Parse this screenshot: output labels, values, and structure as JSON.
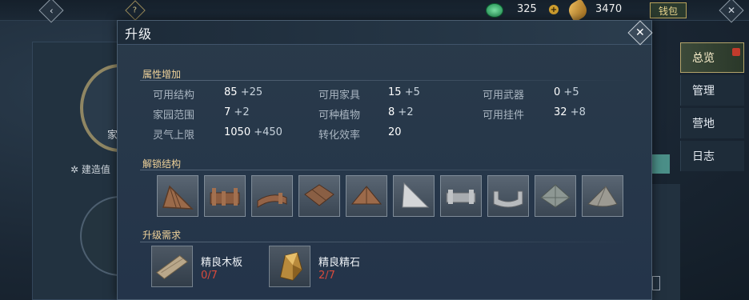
{
  "hud": {
    "jade_count": "325",
    "coin_count": "3470",
    "wallet_label": "钱包",
    "help_symbol": "?"
  },
  "side_tabs": [
    {
      "label": "总览",
      "active": true
    },
    {
      "label": "管理",
      "active": false
    },
    {
      "label": "营地",
      "active": false
    },
    {
      "label": "日志",
      "active": false
    }
  ],
  "background": {
    "home_label": "家",
    "build_label": "建造值"
  },
  "modal": {
    "title": "升级",
    "attributes_title": "属性增加",
    "attributes": [
      {
        "name": "可用结构",
        "value": "85",
        "inc": "+25"
      },
      {
        "name": "可用家具",
        "value": "15",
        "inc": "+5"
      },
      {
        "name": "可用武器",
        "value": "0",
        "inc": "+5"
      },
      {
        "name": "家园范围",
        "value": "7",
        "inc": "+2"
      },
      {
        "name": "可种植物",
        "value": "8",
        "inc": "+2"
      },
      {
        "name": "可用挂件",
        "value": "32",
        "inc": "+8"
      },
      {
        "name": "灵气上限",
        "value": "1050",
        "inc": "+450"
      },
      {
        "name": "转化效率",
        "value": "20",
        "inc": ""
      }
    ],
    "unlock_title": "解锁结构",
    "unlock_structures": [
      "wooden-ramp-structure",
      "wooden-fence-structure",
      "curved-wooden-wall-structure",
      "wooden-floor-tile-structure",
      "wooden-pyramid-roof-structure",
      "stone-triangle-floor-structure",
      "stone-low-wall-structure",
      "curved-stone-wall-structure",
      "stone-pyramid-roof-structure",
      "stone-cone-roof-structure"
    ],
    "requirements_title": "升级需求",
    "requirements": [
      {
        "name": "精良木板",
        "count": "0/7"
      },
      {
        "name": "精良精石",
        "count": "2/7"
      }
    ]
  },
  "colors": {
    "section_title": "#f0d39a",
    "insufficient": "#d94a3c",
    "tab_active_border": "#b4a46a"
  }
}
